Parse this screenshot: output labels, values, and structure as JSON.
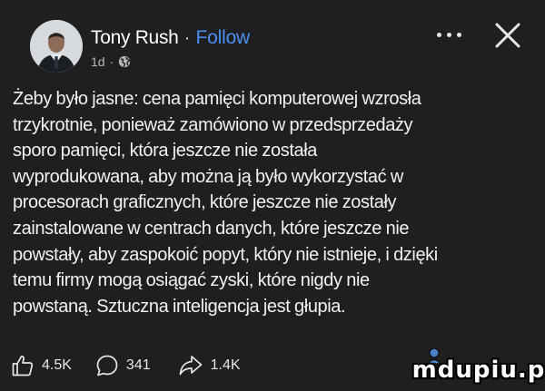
{
  "post": {
    "author": "Tony Rush",
    "separator": "·",
    "follow_label": "Follow",
    "age": "1d",
    "meta_separator": "·",
    "audience_icon": "globe-icon",
    "more_icon": "more-horizontal-icon",
    "close_icon": "close-icon",
    "body_lines": [
      "Żeby było jasne: cena pamięci komputerowej wzrosła",
      "trzykrotnie, ponieważ zamówiono w przedsprzedaży",
      "sporo pamięci, która jeszcze nie została",
      "wyprodukowana, aby można ją było wykorzystać w",
      "procesorach graficznych, które jeszcze nie zostały",
      "zainstalowane w centrach danych, które jeszcze nie",
      "powstały, aby zaspokoić popyt, który nie istnieje, i dzięki",
      "temu firmy mogą osiągać zyski, które nigdy nie",
      "powstaną. Sztuczna inteligencja jest głupia."
    ]
  },
  "actions": {
    "likes": "4.5K",
    "comments": "341",
    "shares": "1.4K",
    "like_icon": "thumbs-up-icon",
    "comment_icon": "comment-bubble-icon",
    "share_icon": "share-arrow-icon"
  },
  "watermark": {
    "text": "mdupiu.pl"
  },
  "colors": {
    "background": "#1f1f21",
    "text": "#f1f1f1",
    "follow": "#4a8ff0",
    "muted": "#b9b9b9"
  }
}
